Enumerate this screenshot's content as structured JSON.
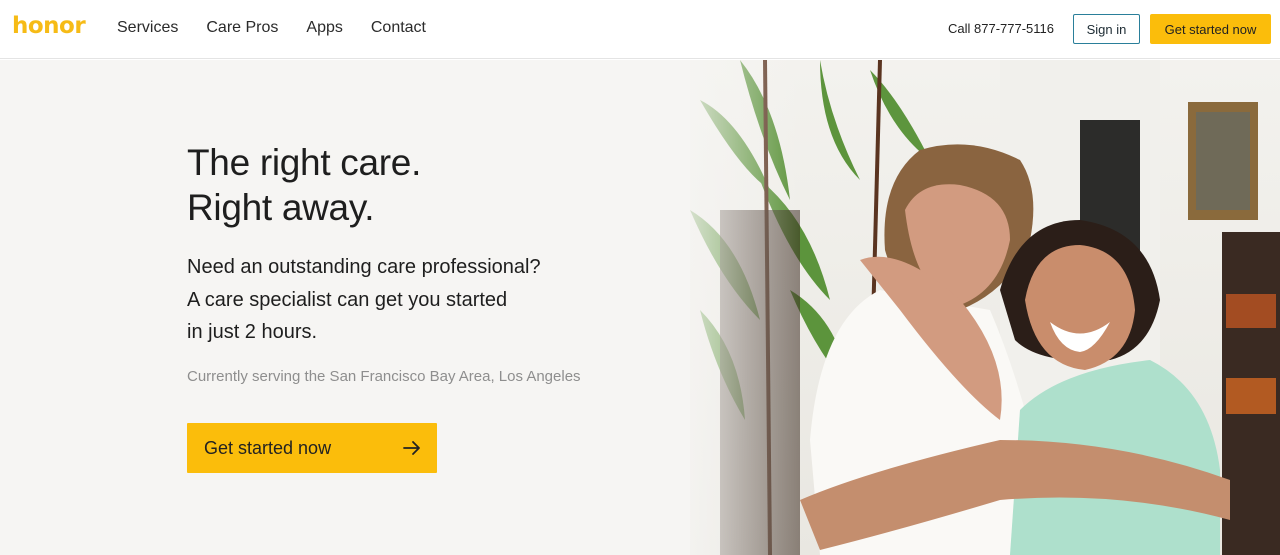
{
  "header": {
    "logo": "honor",
    "nav": [
      "Services",
      "Care Pros",
      "Apps",
      "Contact"
    ],
    "phone": "Call 877-777-5116",
    "signin_label": "Sign in",
    "cta_label": "Get started now"
  },
  "hero": {
    "headline_line1": "The right care.",
    "headline_line2": "Right away.",
    "subhead_line1": "Need an outstanding care professional?",
    "subhead_line2": "A care specialist can get you started",
    "subhead_line3": "in just 2 hours.",
    "serving": "Currently serving the San Francisco Bay Area, Los Angeles",
    "cta_label": "Get started now",
    "cta_icon": "arrow-right-icon"
  },
  "colors": {
    "brand": "#f6bb16",
    "button": "#fbbd0b",
    "signin_border": "#2a7f9a"
  }
}
